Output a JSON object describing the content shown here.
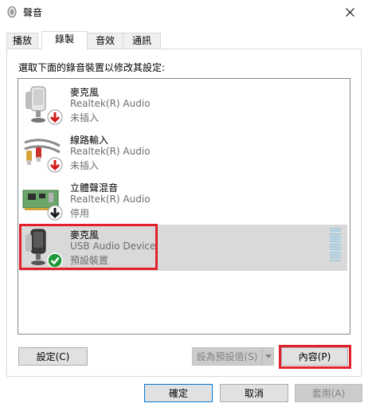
{
  "window": {
    "title": "聲音",
    "icon": "speaker-icon",
    "close_icon": "close-icon"
  },
  "tabs": [
    {
      "label": "播放",
      "active": false
    },
    {
      "label": "錄製",
      "active": true
    },
    {
      "label": "音效",
      "active": false
    },
    {
      "label": "通訊",
      "active": false
    }
  ],
  "instruction": "選取下面的錄音裝置以修改其設定:",
  "devices": [
    {
      "name": "麥克風",
      "driver": "Realtek(R) Audio",
      "status": "未插入",
      "icon": "microphone-icon",
      "badge": "unplugged-red-arrow-icon",
      "selected": false
    },
    {
      "name": "線路輸入",
      "driver": "Realtek(R) Audio",
      "status": "未插入",
      "icon": "line-in-cable-icon",
      "badge": "unplugged-red-arrow-icon",
      "selected": false
    },
    {
      "name": "立體聲混音",
      "driver": "Realtek(R) Audio",
      "status": "停用",
      "icon": "sound-card-icon",
      "badge": "disabled-black-arrow-icon",
      "selected": false
    },
    {
      "name": "麥克風",
      "driver": "USB Audio Device",
      "status": "預設裝置",
      "icon": "microphone-icon",
      "badge": "default-green-check-icon",
      "selected": true
    }
  ],
  "buttons": {
    "configure": "設定(C)",
    "set_default": "設為預設值(S)",
    "properties": "內容(P)",
    "ok": "確定",
    "cancel": "取消",
    "apply": "套用(A)"
  },
  "colors": {
    "highlight": "#e0202b",
    "selected_row": "#d9d9d9",
    "level_meter": "#a6cde0",
    "default_check": "#1e9a3a",
    "unplugged_arrow": "#d41a1a"
  }
}
